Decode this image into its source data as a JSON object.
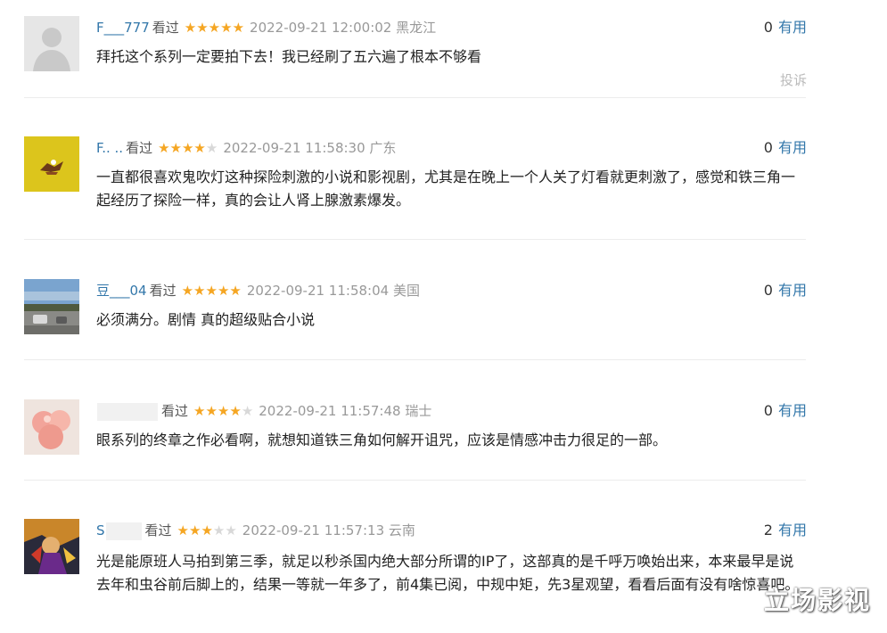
{
  "comments": [
    {
      "username": "F___777",
      "watched": "看过",
      "rating": 5,
      "time": "2022-09-21 12:00:02",
      "location": "黑龙江",
      "useful_count": "0",
      "useful_label": "有用",
      "text": "拜托这个系列一定要拍下去！我已经刷了五六遍了根本不够看",
      "report": "投诉",
      "avatar": "default-avatar"
    },
    {
      "username": "F.. ..",
      "watched": "看过",
      "rating": 4,
      "time": "2022-09-21 11:58:30",
      "location": "广东",
      "useful_count": "0",
      "useful_label": "有用",
      "text": "一直都很喜欢鬼吹灯这种探险刺激的小说和影视剧，尤其是在晚上一个人关了灯看就更刺激了，感觉和铁三角一起经历了探险一样，真的会让人肾上腺激素爆发。",
      "avatar": "cartoon-avatar"
    },
    {
      "username": "豆___04",
      "watched": "看过",
      "rating": 5,
      "time": "2022-09-21 11:58:04",
      "location": "美国",
      "useful_count": "0",
      "useful_label": "有用",
      "text": "必须满分。剧情 真的超级贴合小说",
      "avatar": "street-photo-avatar"
    },
    {
      "username": "",
      "watched": "看过",
      "rating": 4,
      "time": "2022-09-21 11:57:48",
      "location": "瑞士",
      "useful_count": "0",
      "useful_label": "有用",
      "text": "眼系列的终章之作必看啊，就想知道铁三角如何解开诅咒，应该是情感冲击力很足的一部。",
      "avatar": "peach-avatar"
    },
    {
      "username": "S",
      "watched": "看过",
      "rating": 3,
      "time": "2022-09-21 11:57:13",
      "location": "云南",
      "useful_count": "2",
      "useful_label": "有用",
      "text": "光是能原班人马拍到第三季，就足以秒杀国内绝大部分所谓的IP了，这部真的是千呼万唤始出来，本来最早是说去年和虫谷前后脚上的，结果一等就一年多了，前4集已阅，中规中矩，先3星观望，看看后面有没有啥惊喜吧。",
      "avatar": "comic-hero-avatar"
    }
  ],
  "colors": {
    "accent": "#3377aa",
    "star_on": "#f5a623",
    "star_off": "#d8d8d8",
    "meta_gray": "#999999"
  },
  "watermark": "立场影视"
}
